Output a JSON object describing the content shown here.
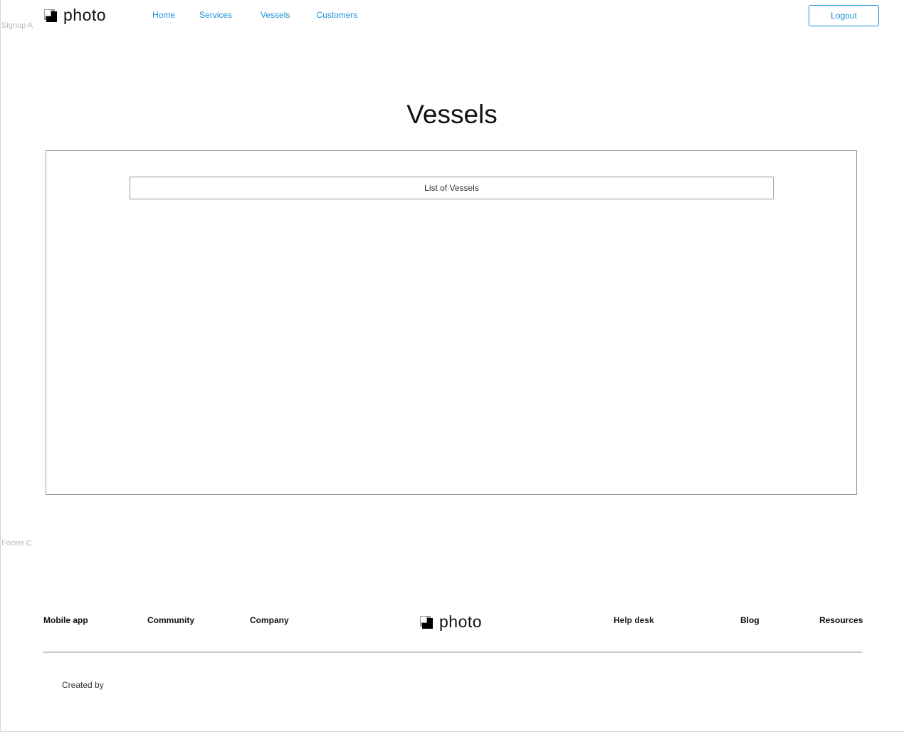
{
  "labels": {
    "top_section": "Signup A",
    "footer_section": "Footer C"
  },
  "header": {
    "logo_text": "photo",
    "nav": [
      "Home",
      "Services",
      "Vessels",
      "Customers"
    ],
    "logout_label": "Logout"
  },
  "main": {
    "title": "Vessels",
    "list_header": "List of Vessels"
  },
  "footer": {
    "links_left": [
      "Mobile app",
      "Community",
      "Company"
    ],
    "logo_text": "photo",
    "links_right": [
      "Help desk",
      "Blog",
      "Resources"
    ],
    "created_by": "Created by"
  },
  "colors": {
    "accent": "#1a8fd6",
    "border": "#9a9a9a"
  }
}
